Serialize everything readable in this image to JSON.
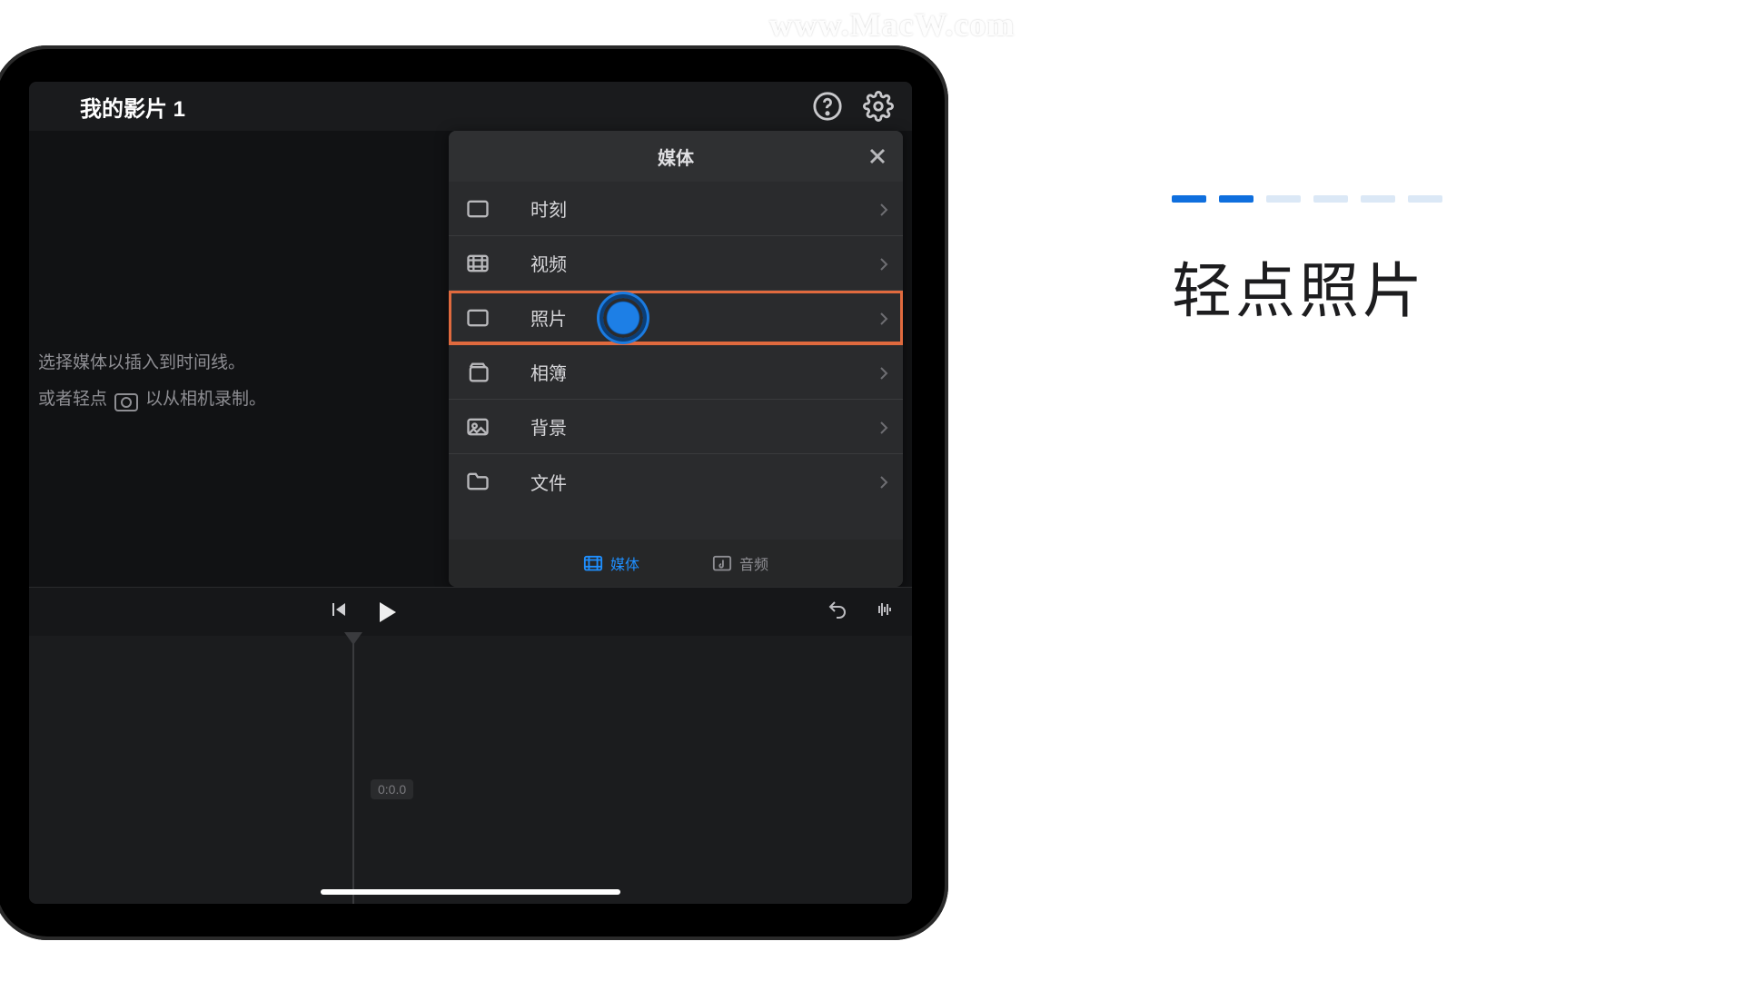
{
  "watermark": "www.MacW.com",
  "project_title": "我的影片 1",
  "hint_line1": "选择媒体以插入到时间线。",
  "hint_line2_prefix": "或者轻点",
  "hint_line2_suffix": "以从相机录制。",
  "panel": {
    "title": "媒体",
    "items": [
      {
        "icon": "moments",
        "label": "时刻"
      },
      {
        "icon": "video",
        "label": "视频"
      },
      {
        "icon": "photo",
        "label": "照片",
        "highlighted": true
      },
      {
        "icon": "album",
        "label": "相簿"
      },
      {
        "icon": "background",
        "label": "背景"
      },
      {
        "icon": "files",
        "label": "文件"
      }
    ],
    "tabs": {
      "media": "媒体",
      "audio": "音频"
    }
  },
  "timeline_zero": "0:0.0",
  "instruction": {
    "steps_total": 6,
    "steps_done": 2,
    "text": "轻点照片"
  }
}
